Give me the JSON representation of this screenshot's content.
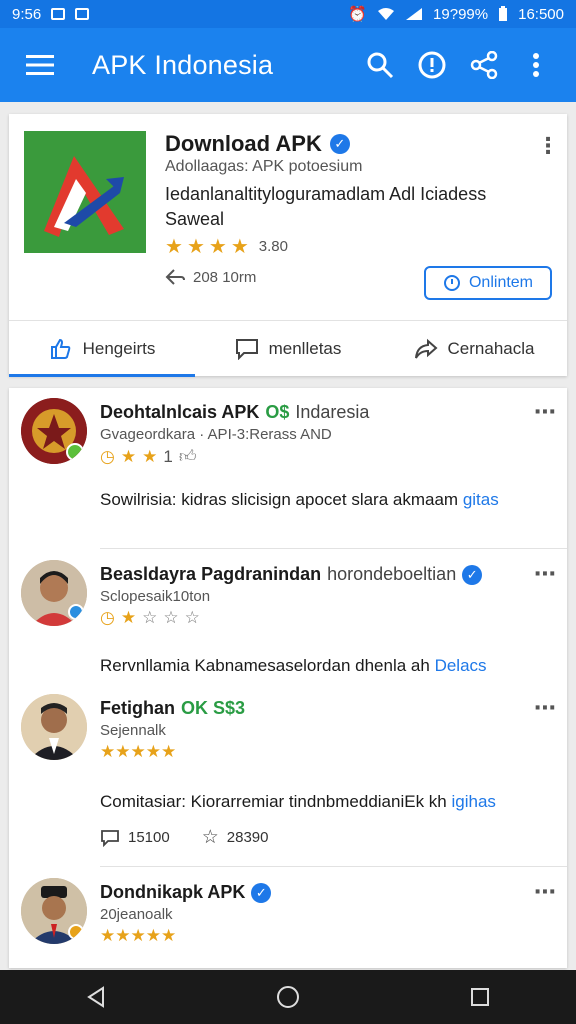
{
  "status_bar": {
    "left_text": "9:56",
    "battery_text": "19?99%",
    "right_text": "16:500"
  },
  "app_bar": {
    "title": "APK Indonesia",
    "icons": [
      "menu-icon",
      "search-icon",
      "info-icon",
      "share-icon",
      "more-vert-icon"
    ]
  },
  "app_card": {
    "name": "Download APK",
    "subtitle": "Adollaagas: APK potoesium",
    "description": "Iedanlanaltityloguramadlam Adl Iciadess Saweal",
    "rating_text": "3.80",
    "stars": 3.5,
    "downloads": "208 10rm",
    "install_label": "Onlintem",
    "tabs": [
      {
        "label": "Hengeirts",
        "icon": "thumbs-up-icon",
        "active": true
      },
      {
        "label": "menlletas",
        "icon": "comment-icon",
        "active": false
      },
      {
        "label": "Cernahacla",
        "icon": "share-arrow-icon",
        "active": false
      }
    ]
  },
  "feed": {
    "posts": [
      {
        "name": "Deohtalnlcais APK",
        "badge": "O$",
        "tag": "Indaresia",
        "subtitle": "Gvageordkara · API-3:Rerass AND",
        "stars_text": "1",
        "text": "Sowilrisia: kidras slicisign apocet slara akmaam",
        "link": "gitas"
      },
      {
        "name": "Beasldayra Pagdranindan",
        "tag": "horondeboeltian",
        "subtitle": "Sclopesaik10ton",
        "stars_text": "",
        "text": "Rervnllamia Kabnamesaselordan dhenla ah",
        "link": "Delacs"
      },
      {
        "name": "Fetighan",
        "badge": "OK S$3",
        "subtitle": "Sejennalk",
        "stars_text": "",
        "text": "Comitasiar: Kiorarremiar tindnbmeddianiEk kh",
        "link": "igihas",
        "comments": "15100",
        "favorites": "28390"
      },
      {
        "name": "Dondnikapk APK",
        "subtitle": "20jeanoalk",
        "stars_text": ""
      }
    ]
  },
  "colors": {
    "primary": "#1b82ee",
    "statusbar": "#1475e3",
    "accent_link": "#1e78e8",
    "star": "#e7a21a",
    "verified_green": "#2a9c44",
    "navbar": "#1a1a1a"
  },
  "nav_bar": {
    "icons": [
      "back-icon",
      "home-icon",
      "recents-icon"
    ]
  }
}
